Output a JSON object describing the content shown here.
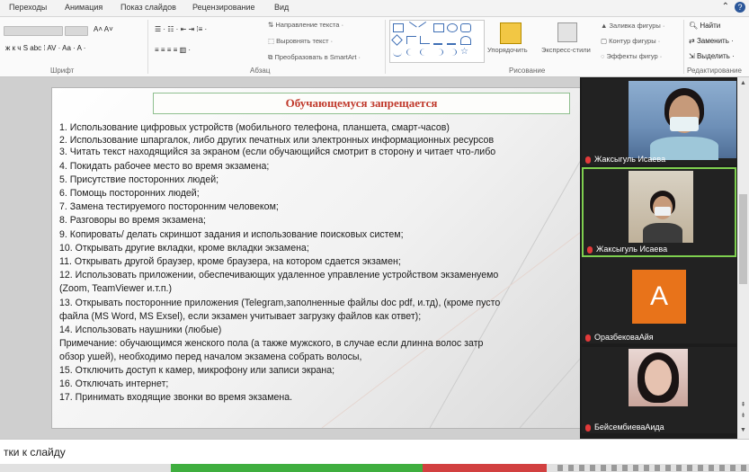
{
  "ribbon": {
    "tabs": [
      "Переходы",
      "Анимация",
      "Показ слайдов",
      "Рецензирование",
      "Вид"
    ],
    "help": "?",
    "groups": {
      "font": "Шрифт",
      "paragraph": "Абзац",
      "drawing": "Рисование",
      "editing": "Редактирование"
    },
    "paragraph_items": {
      "text_direction": "Направление текста",
      "align_text": "Выровнять текст",
      "convert_smartart": "Преобразовать в SmartArt"
    },
    "drawing_items": {
      "arrange": "Упорядочить",
      "quick_styles": "Экспресс-стили",
      "shape_fill": "Заливка фигуры",
      "shape_outline": "Контур фигуры",
      "shape_effects": "Эффекты фигур"
    },
    "editing_items": {
      "find": "Найти",
      "replace": "Заменить",
      "select": "Выделить"
    }
  },
  "slide": {
    "title": "Обучающемуся запрещается",
    "rules": [
      "1.   Использование цифровых устройств (мобильного телефона, планшета, смарт-часов)",
      "2.   Использование шпаргалок, либо других печатных или электронных информационных ресурсов",
      "3.   Читать текст находящийся за экраном (если обучающийся смотрит в сторону и читает что-либо",
      "4.   Покидать рабочее место во время экзамена;",
      "5.   Присутствие посторонних людей;",
      "6.   Помощь посторонних людей;",
      "7.   Замена тестируемого посторонним человеком;",
      "8.   Разговоры во время экзамена;",
      "9.   Копировать/ делать скриншот задания и использование поисковых систем;",
      "10. Открывать другие вкладки, кроме вкладки экзамена;",
      "11. Открывать другой браузер, кроме браузера, на котором сдается экзамен;",
      "12. Использовать приложении, обеспечивающих удаленное управление устройством экзаменуемо",
      "      (Zoom, TeamViewer и.т.п.)",
      "13. Открывать посторонние приложения (Telegram,заполненные файлы doc pdf, и.тд), (кроме пусто",
      "      файла (MS Word, MS Exsel), если экзамен учитывает загрузку файлов как ответ);",
      "14.   Использовать наушники (любые)",
      "        Примечание: обучающимся женского пола (а также мужского, в случае если длинна волос затр",
      "        обзор ушей), необходимо перед началом экзамена собрать волосы,",
      "15. Отключить доступ к камер, микрофону или записи экрана;",
      "16. Отключать интернет;",
      "17. Принимать входящие звонки во время экзамена."
    ]
  },
  "participants": [
    {
      "name": "Жаксыгуль Исаева"
    },
    {
      "name": "Жаксыгуль Исаева"
    },
    {
      "name": "ОразбековаАйя",
      "avatar_letter": "A"
    },
    {
      "name": "БейсембиеваАида"
    }
  ],
  "notes": {
    "text": "тки к слайду"
  },
  "colors": {
    "title": "#c0392b",
    "active_speaker": "#7ecf4f",
    "avatar": "#e8731a",
    "mic_muted": "#e23a3a"
  }
}
